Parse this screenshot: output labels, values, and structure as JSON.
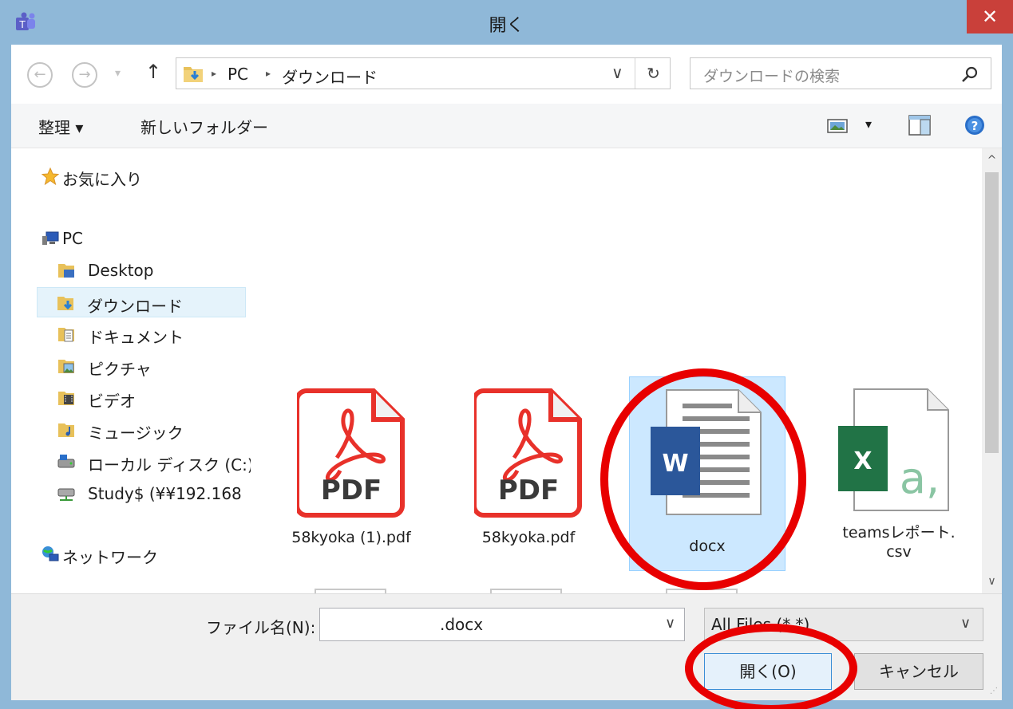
{
  "window": {
    "title": "開く",
    "close_glyph": "✕"
  },
  "nav_buttons": {
    "back_glyph": "←",
    "forward_glyph": "→",
    "dropdown_glyph": "▾",
    "up_glyph": "↑"
  },
  "address": {
    "crumbs": [
      "PC",
      "ダウンロード"
    ],
    "separator": "▸",
    "dropdown_glyph": "∨",
    "refresh_glyph": "↻"
  },
  "search": {
    "placeholder": "ダウンロードの検索"
  },
  "toolbar": {
    "organize_label": "整理 ▾",
    "new_folder_label": "新しいフォルダー",
    "view_dropdown_glyph": "▾"
  },
  "navpane": {
    "items": [
      {
        "label": "お気に入り",
        "icon": "star-icon"
      },
      {
        "label": "PC",
        "icon": "computer-icon"
      },
      {
        "label": "Desktop",
        "icon": "desktop-folder-icon"
      },
      {
        "label": "ダウンロード",
        "icon": "downloads-folder-icon"
      },
      {
        "label": "ドキュメント",
        "icon": "documents-folder-icon"
      },
      {
        "label": "ピクチャ",
        "icon": "pictures-folder-icon"
      },
      {
        "label": "ビデオ",
        "icon": "videos-folder-icon"
      },
      {
        "label": "ミュージック",
        "icon": "music-folder-icon"
      },
      {
        "label": "ローカル ディスク (C:)",
        "icon": "drive-icon"
      },
      {
        "label": "Study$ (¥¥192.168",
        "icon": "network-drive-icon"
      },
      {
        "label": "ネットワーク",
        "icon": "network-icon"
      }
    ]
  },
  "files": [
    {
      "name": "58kyoka (1).pdf",
      "badge": "PDF",
      "type": "pdf-file-icon"
    },
    {
      "name": "58kyoka.pdf",
      "badge": "PDF",
      "type": "pdf-file-icon"
    },
    {
      "name": "docx",
      "badge": "W",
      "type": "word-file-icon",
      "selected": true
    },
    {
      "name_line1": "teamsレポート.",
      "name_line2": "csv",
      "badge": "X",
      "type": "excel-file-icon"
    }
  ],
  "scrollbar": {
    "up_glyph": "^",
    "down_glyph": "∨"
  },
  "bottom": {
    "filename_label": "ファイル名(N):",
    "filename_value": ".docx",
    "filename_dropdown_glyph": "∨",
    "filetype_value": "All Files (*.*)",
    "filetype_dropdown_glyph": "∨",
    "open_label": "開く(O)",
    "cancel_label": "キャンセル"
  },
  "colors": {
    "titlebar": "#8fb8d8",
    "close": "#c9403a",
    "selection": "#cce8ff",
    "annotation": "#e80000",
    "pdf_red": "#e8312a",
    "word_blue": "#2b579a",
    "excel_green": "#217346"
  }
}
